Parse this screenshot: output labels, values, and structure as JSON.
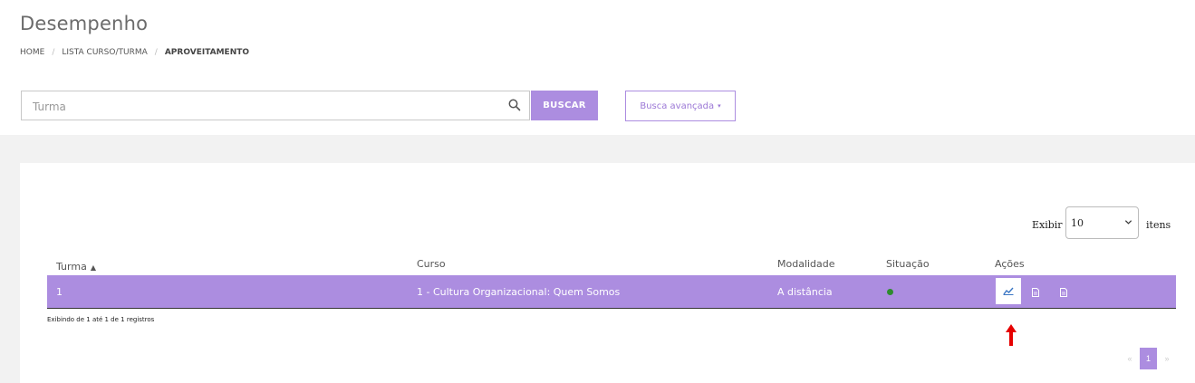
{
  "page": {
    "title": "Desempenho",
    "breadcrumb": [
      "HOME",
      "LISTA CURSO/TURMA",
      "APROVEITAMENTO"
    ]
  },
  "search": {
    "placeholder": "Turma",
    "button_label": "BUSCAR",
    "advanced_label": "Busca avançada"
  },
  "pagination_controls": {
    "exibir_label": "Exibir",
    "per_page_value": "10",
    "itens_label": "itens"
  },
  "table": {
    "columns": [
      "Turma",
      "Curso",
      "Modalidade",
      "Situação",
      "Ações"
    ],
    "rows": [
      {
        "turma": "1",
        "curso": "1 - Cultura Organizacional: Quem Somos",
        "modalidade": "A distância",
        "situacao_icon": "power-icon",
        "acoes_icons": [
          "chart-line-icon",
          "document-icon",
          "document-icon"
        ]
      }
    ],
    "info": "Exibindo de 1 até 1 de 1 registros"
  },
  "pager": {
    "prev": "«",
    "current": "1",
    "next": "»"
  },
  "colors": {
    "accent": "#ac8de0",
    "status_green": "#2e8b2e",
    "arrow_red": "#e60000"
  }
}
